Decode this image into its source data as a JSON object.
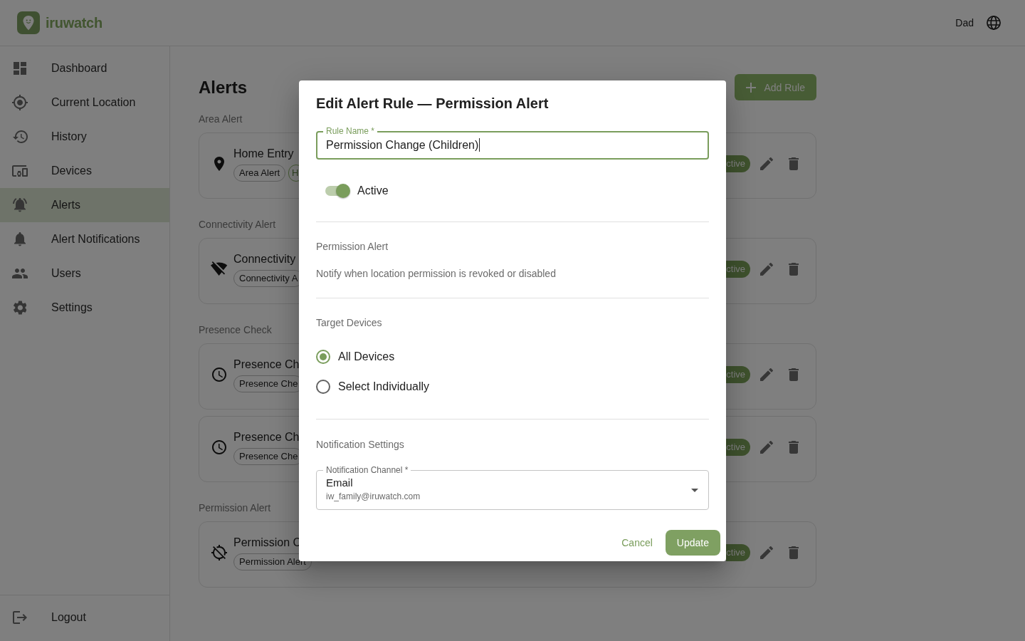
{
  "header": {
    "brand": "iruwatch",
    "user": "Dad"
  },
  "sidebar": {
    "items": [
      {
        "label": "Dashboard",
        "selected": false
      },
      {
        "label": "Current Location",
        "selected": false
      },
      {
        "label": "History",
        "selected": false
      },
      {
        "label": "Devices",
        "selected": false
      },
      {
        "label": "Alerts",
        "selected": true
      },
      {
        "label": "Alert Notifications",
        "selected": false
      },
      {
        "label": "Users",
        "selected": false
      },
      {
        "label": "Settings",
        "selected": false
      }
    ],
    "logout": {
      "label": "Logout"
    }
  },
  "main": {
    "title": "Alerts",
    "add_button": "Add Rule",
    "sections": [
      {
        "label": "Area Alert",
        "rules": [
          {
            "title": "Home Entry",
            "tags": [
              {
                "label": "Area Alert",
                "kind": "type"
              },
              {
                "label": "H",
                "kind": "area"
              }
            ],
            "status": "ctive",
            "active": true
          }
        ]
      },
      {
        "label": "Connectivity Alert",
        "rules": [
          {
            "title": "Connectivity",
            "tags": [
              {
                "label": "Connectivity A",
                "kind": "type"
              }
            ],
            "status": "ctive",
            "active": true
          }
        ]
      },
      {
        "label": "Presence Check",
        "rules": [
          {
            "title": "Presence Ch",
            "tags": [
              {
                "label": "Presence Che",
                "kind": "type"
              }
            ],
            "status": "ctive",
            "active": true
          },
          {
            "title": "Presence Ch",
            "tags": [
              {
                "label": "Presence Che",
                "kind": "type"
              }
            ],
            "status": "ctive",
            "active": true
          }
        ]
      },
      {
        "label": "Permission Alert",
        "rules": [
          {
            "title": "Permission C",
            "tags": [
              {
                "label": "Permission Alert",
                "kind": "type"
              }
            ],
            "status": "ctive",
            "active": true
          }
        ]
      }
    ]
  },
  "dialog": {
    "title": "Edit Alert Rule — Permission Alert",
    "rule_name": {
      "label": "Rule Name *",
      "value": "Permission Change (Children)",
      "focused": true
    },
    "active_switch": {
      "label": "Active",
      "on": true
    },
    "alert_type": {
      "heading": "Permission Alert",
      "description": "Notify when location permission is revoked or disabled"
    },
    "target_devices": {
      "heading": "Target Devices",
      "options": [
        {
          "label": "All Devices",
          "selected": true
        },
        {
          "label": "Select Individually",
          "selected": false
        }
      ]
    },
    "notification_settings": {
      "heading": "Notification Settings",
      "channel": {
        "label": "Notification Channel *",
        "value": "Email",
        "detail": "iw_family@iruwatch.com"
      }
    },
    "buttons": [
      {
        "label": "Cancel",
        "kind": "text"
      },
      {
        "label": "Update",
        "kind": "contained"
      }
    ]
  }
}
